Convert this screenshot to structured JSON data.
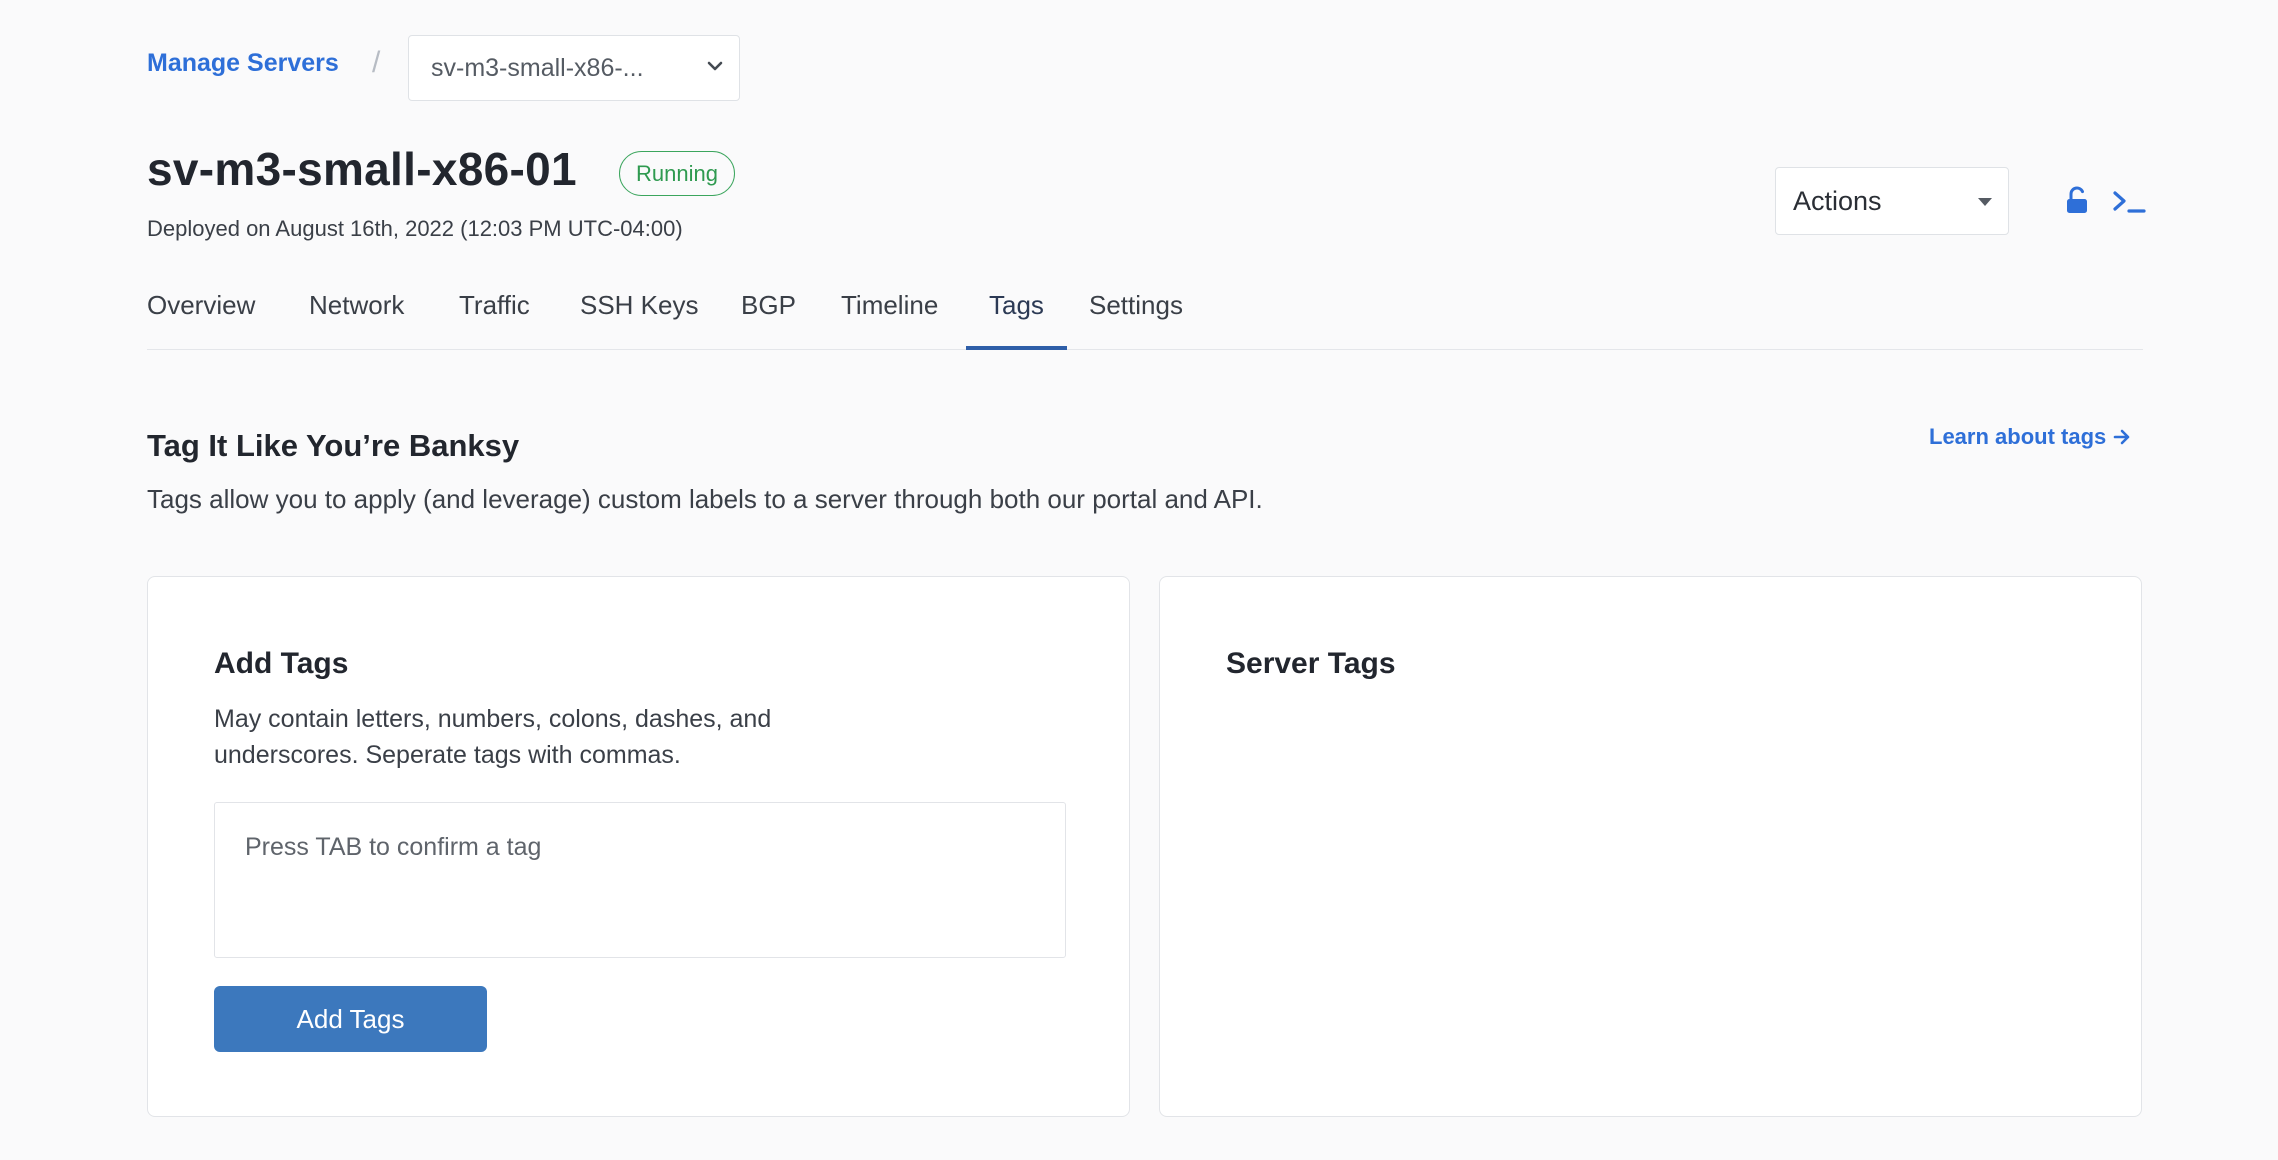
{
  "breadcrumb": {
    "link_label": "Manage Servers",
    "separator": "/",
    "server_select_value": "sv-m3-small-x86-..."
  },
  "server": {
    "name": "sv-m3-small-x86-01",
    "status": "Running",
    "deployed": "Deployed on August 16th, 2022 (12:03 PM UTC-04:00)"
  },
  "header": {
    "actions_label": "Actions"
  },
  "tabs": [
    {
      "label": "Overview"
    },
    {
      "label": "Network"
    },
    {
      "label": "Traffic"
    },
    {
      "label": "SSH Keys"
    },
    {
      "label": "BGP"
    },
    {
      "label": "Timeline"
    },
    {
      "label": "Tags",
      "active": true
    },
    {
      "label": "Settings"
    }
  ],
  "section": {
    "title": "Tag It Like You’re Banksy",
    "learn_link": "Learn about tags",
    "description": "Tags allow you to apply (and leverage) custom labels to a server through both our portal and API."
  },
  "add_tags_card": {
    "title": "Add Tags",
    "description": "May contain letters, numbers, colons, dashes, and underscores. Seperate tags with commas.",
    "input_placeholder": "Press TAB to confirm a tag",
    "input_value": "",
    "button_label": "Add Tags"
  },
  "server_tags_card": {
    "title": "Server Tags"
  },
  "colors": {
    "accent": "#2e6fd8",
    "button": "#3c78bd",
    "status_green": "#3ba55d",
    "tab_underline": "#2e5ea8"
  },
  "icons": {
    "select_chevron": "chevron-down-icon",
    "actions_caret": "caret-down-icon",
    "lock": "unlock-icon",
    "console": "terminal-icon",
    "learn_arrow": "arrow-right-icon"
  }
}
